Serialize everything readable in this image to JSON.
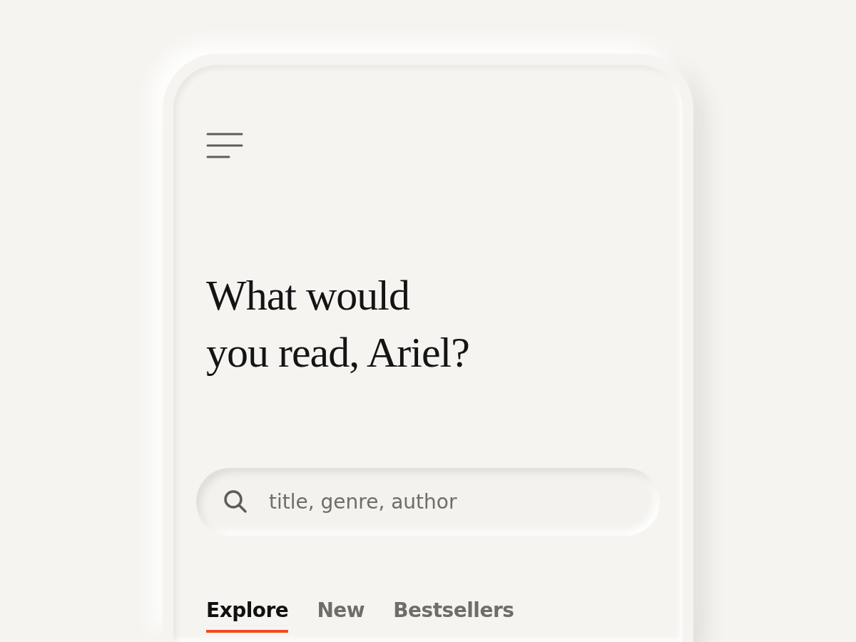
{
  "heading": {
    "lines": [
      "What would",
      "you read, Ariel?"
    ]
  },
  "search": {
    "placeholder": "title, genre, author"
  },
  "tabs": [
    {
      "label": "Explore",
      "selected": true
    },
    {
      "label": "New",
      "selected": false
    },
    {
      "label": "Bestsellers",
      "selected": false
    }
  ]
}
